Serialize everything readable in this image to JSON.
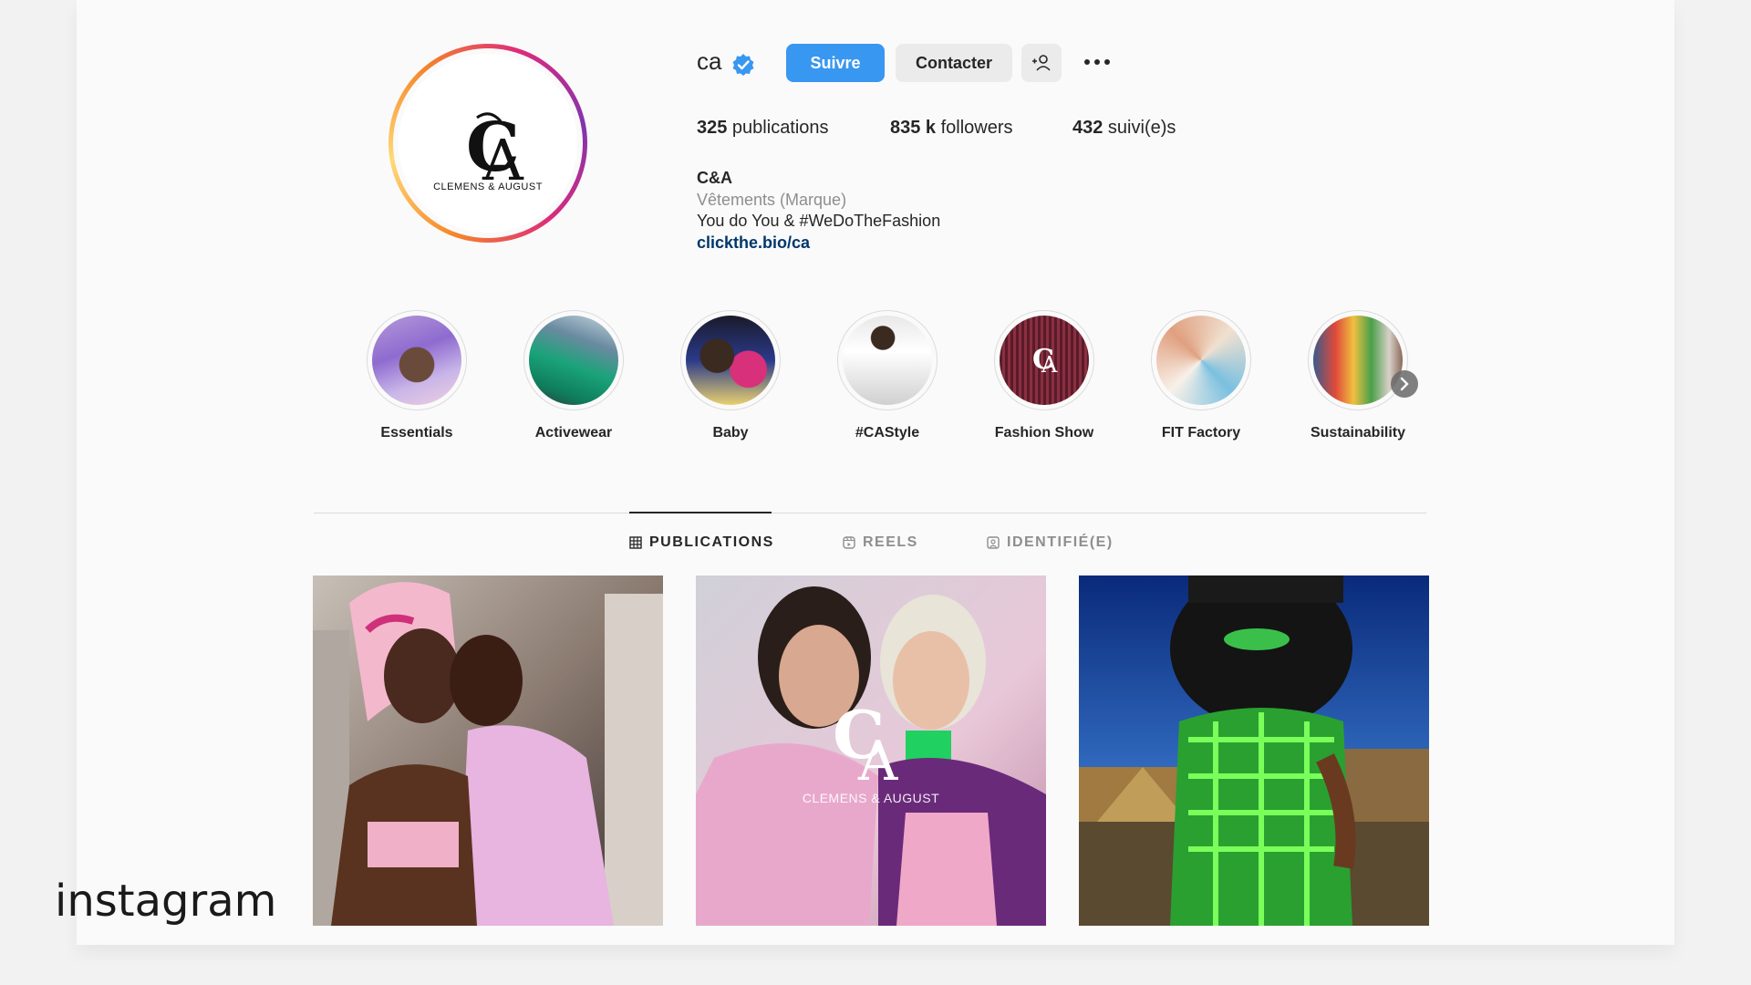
{
  "profile": {
    "username": "ca",
    "verified": true,
    "avatar_logo_monogram": "CA",
    "avatar_logo_subtitle": "CLEMENS & AUGUST"
  },
  "actions": {
    "follow_label": "Suivre",
    "contact_label": "Contacter",
    "add_user_icon": "add-user-icon",
    "more_icon": "more-options-icon"
  },
  "stats": [
    {
      "value": "325",
      "label": " publications"
    },
    {
      "value": "835 k",
      "label": " followers"
    },
    {
      "value": "432",
      "label": " suivi(e)s"
    }
  ],
  "bio": {
    "name": "C&A",
    "category": "Vêtements (Marque)",
    "text": "You do You & #WeDoTheFashion",
    "link": "clickthe.bio/ca"
  },
  "highlights": [
    {
      "label": "Essentials"
    },
    {
      "label": "Activewear"
    },
    {
      "label": "Baby"
    },
    {
      "label": "#CAStyle"
    },
    {
      "label": "Fashion Show"
    },
    {
      "label": "FIT Factory"
    },
    {
      "label": "Sustainability"
    }
  ],
  "tabs": [
    {
      "label": "PUBLICATIONS",
      "icon": "grid-icon",
      "active": true
    },
    {
      "label": "REELS",
      "icon": "reels-icon",
      "active": false
    },
    {
      "label": "IDENTIFIÉ(E)",
      "icon": "tagged-icon",
      "active": false
    }
  ],
  "posts": [
    {
      "overlay_subtitle": ""
    },
    {
      "overlay_subtitle": "CLEMENS & AUGUST"
    },
    {
      "overlay_subtitle": ""
    }
  ],
  "watermark": "instagram",
  "colors": {
    "accent_blue": "#3897f0",
    "link_blue": "#00376b",
    "muted_gray": "#8e8e8e",
    "button_gray": "#ebebeb"
  }
}
